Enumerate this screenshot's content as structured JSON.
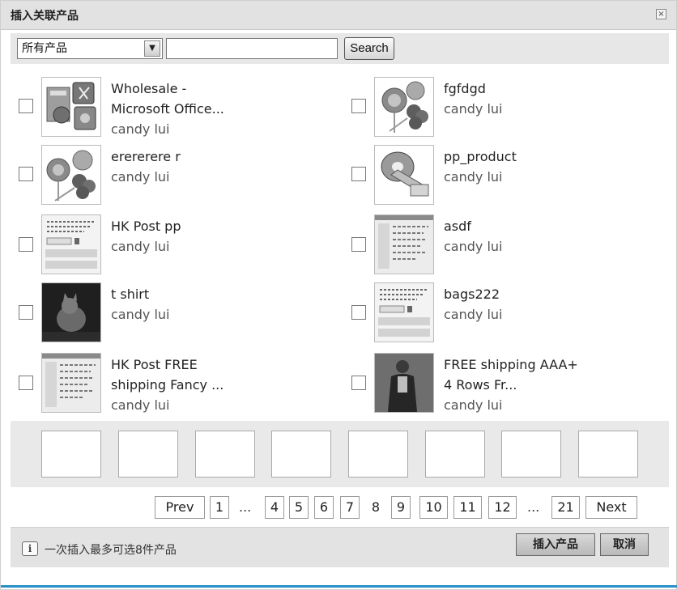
{
  "dialog": {
    "title": "插入关联产品",
    "close_glyph": "×"
  },
  "filter": {
    "category_selected": "所有产品",
    "search_value": "",
    "search_button": "Search"
  },
  "products": [
    {
      "name": "Wholesale -\nMicrosoft Office...",
      "author": "candy lui",
      "thumb": "office-icon"
    },
    {
      "name": "fgfdgd",
      "author": "candy lui",
      "thumb": "lollipop-icon"
    },
    {
      "name": "erererere r",
      "author": "candy lui",
      "thumb": "lollipop-icon"
    },
    {
      "name": "pp_product",
      "author": "candy lui",
      "thumb": "disc-icon"
    },
    {
      "name": "HK Post pp",
      "author": "candy lui",
      "thumb": "screenshot-icon"
    },
    {
      "name": "asdf",
      "author": "candy lui",
      "thumb": "screenshot-icon"
    },
    {
      "name": "t shirt",
      "author": "candy lui",
      "thumb": "cat-photo"
    },
    {
      "name": "bags222",
      "author": "candy lui",
      "thumb": "screenshot-icon"
    },
    {
      "name": "HK Post FREE\nshipping Fancy ...",
      "author": "candy lui",
      "thumb": "screenshot-icon"
    },
    {
      "name": "FREE shipping AAA+\n4 Rows Fr...",
      "author": "candy lui",
      "thumb": "person-photo"
    }
  ],
  "pagination": {
    "prev": "Prev",
    "next": "Next",
    "current": "8",
    "ellipsis": "...",
    "pages": [
      "1",
      "4",
      "5",
      "6",
      "7",
      "9",
      "10",
      "11",
      "12",
      "21"
    ]
  },
  "footer": {
    "tip": "一次插入最多可选8件产品",
    "insert_button": "插入产品",
    "cancel_button": "取消"
  },
  "colors": {
    "accent_line": "#2a8fc6"
  }
}
